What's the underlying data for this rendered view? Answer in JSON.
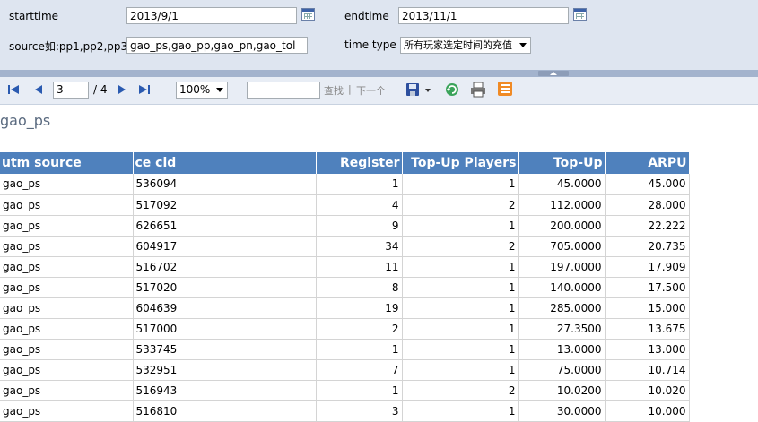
{
  "params": {
    "starttime_label": "starttime",
    "starttime_value": "2013/9/1",
    "endtime_label": "endtime",
    "endtime_value": "2013/11/1",
    "source_label": "source如:pp1,pp2,pp3",
    "source_value": "gao_ps,gao_pp,gao_pn,gao_tol",
    "timetype_label": "time type",
    "timetype_selected": "所有玩家选定时间的充值"
  },
  "toolbar": {
    "page_current": "3",
    "page_total": "/ 4",
    "zoom": "100%",
    "find_placeholder": "",
    "find_label": "查找",
    "separator": "|",
    "next_label": "下一个"
  },
  "icons": {
    "first": "first-page-icon",
    "prev": "previous-page-icon",
    "next": "next-page-icon",
    "last": "last-page-icon",
    "export": "export-save-icon",
    "refresh": "refresh-icon",
    "print": "print-icon",
    "feed": "atom-feed-icon",
    "calendar": "calendar-icon"
  },
  "colors": {
    "panel_bg": "#dee5f0",
    "header_bg": "#4f81bd",
    "toolbar_bg": "#e8edf5",
    "title_color": "#5b6b80"
  },
  "report": {
    "title": "gao_ps",
    "columns": [
      "utm source",
      "ce cid",
      "Register",
      "Top-Up Players",
      "Top-Up",
      "ARPU"
    ],
    "rows": [
      [
        "gao_ps",
        "536094",
        "1",
        "1",
        "45.0000",
        "45.000"
      ],
      [
        "gao_ps",
        "517092",
        "4",
        "2",
        "112.0000",
        "28.000"
      ],
      [
        "gao_ps",
        "626651",
        "9",
        "1",
        "200.0000",
        "22.222"
      ],
      [
        "gao_ps",
        "604917",
        "34",
        "2",
        "705.0000",
        "20.735"
      ],
      [
        "gao_ps",
        "516702",
        "11",
        "1",
        "197.0000",
        "17.909"
      ],
      [
        "gao_ps",
        "517020",
        "8",
        "1",
        "140.0000",
        "17.500"
      ],
      [
        "gao_ps",
        "604639",
        "19",
        "1",
        "285.0000",
        "15.000"
      ],
      [
        "gao_ps",
        "517000",
        "2",
        "1",
        "27.3500",
        "13.675"
      ],
      [
        "gao_ps",
        "533745",
        "1",
        "1",
        "13.0000",
        "13.000"
      ],
      [
        "gao_ps",
        "532951",
        "7",
        "1",
        "75.0000",
        "10.714"
      ],
      [
        "gao_ps",
        "516943",
        "1",
        "2",
        "10.0200",
        "10.020"
      ],
      [
        "gao_ps",
        "516810",
        "3",
        "1",
        "30.0000",
        "10.000"
      ]
    ]
  }
}
